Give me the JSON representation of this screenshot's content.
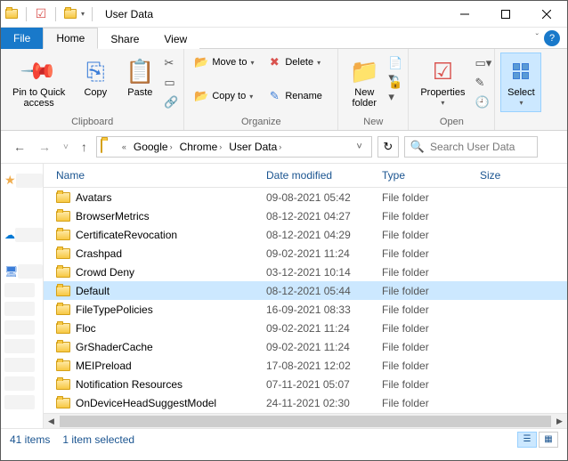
{
  "window": {
    "title": "User Data"
  },
  "ribbon": {
    "file": "File",
    "tabs": [
      "Home",
      "Share",
      "View"
    ],
    "groups": {
      "clipboard": {
        "label": "Clipboard",
        "pin": "Pin to Quick\naccess",
        "copy": "Copy",
        "paste": "Paste"
      },
      "organize": {
        "label": "Organize",
        "moveto": "Move to",
        "copyto": "Copy to",
        "delete": "Delete",
        "rename": "Rename"
      },
      "new": {
        "label": "New",
        "newfolder": "New\nfolder"
      },
      "open": {
        "label": "Open",
        "properties": "Properties"
      },
      "select": {
        "label": "Select",
        "select": "Select"
      }
    }
  },
  "breadcrumb": [
    "Google",
    "Chrome",
    "User Data"
  ],
  "search": {
    "placeholder": "Search User Data"
  },
  "columns": {
    "name": "Name",
    "date": "Date modified",
    "type": "Type",
    "size": "Size"
  },
  "items": [
    {
      "name": "Avatars",
      "date": "09-08-2021 05:42",
      "type": "File folder"
    },
    {
      "name": "BrowserMetrics",
      "date": "08-12-2021 04:27",
      "type": "File folder"
    },
    {
      "name": "CertificateRevocation",
      "date": "08-12-2021 04:29",
      "type": "File folder"
    },
    {
      "name": "Crashpad",
      "date": "09-02-2021 11:24",
      "type": "File folder"
    },
    {
      "name": "Crowd Deny",
      "date": "03-12-2021 10:14",
      "type": "File folder"
    },
    {
      "name": "Default",
      "date": "08-12-2021 05:44",
      "type": "File folder",
      "selected": true
    },
    {
      "name": "FileTypePolicies",
      "date": "16-09-2021 08:33",
      "type": "File folder"
    },
    {
      "name": "Floc",
      "date": "09-02-2021 11:24",
      "type": "File folder"
    },
    {
      "name": "GrShaderCache",
      "date": "09-02-2021 11:24",
      "type": "File folder"
    },
    {
      "name": "MEIPreload",
      "date": "17-08-2021 12:02",
      "type": "File folder"
    },
    {
      "name": "Notification Resources",
      "date": "07-11-2021 05:07",
      "type": "File folder"
    },
    {
      "name": "OnDeviceHeadSuggestModel",
      "date": "24-11-2021 02:30",
      "type": "File folder"
    }
  ],
  "status": {
    "count": "41 items",
    "selection": "1 item selected"
  }
}
